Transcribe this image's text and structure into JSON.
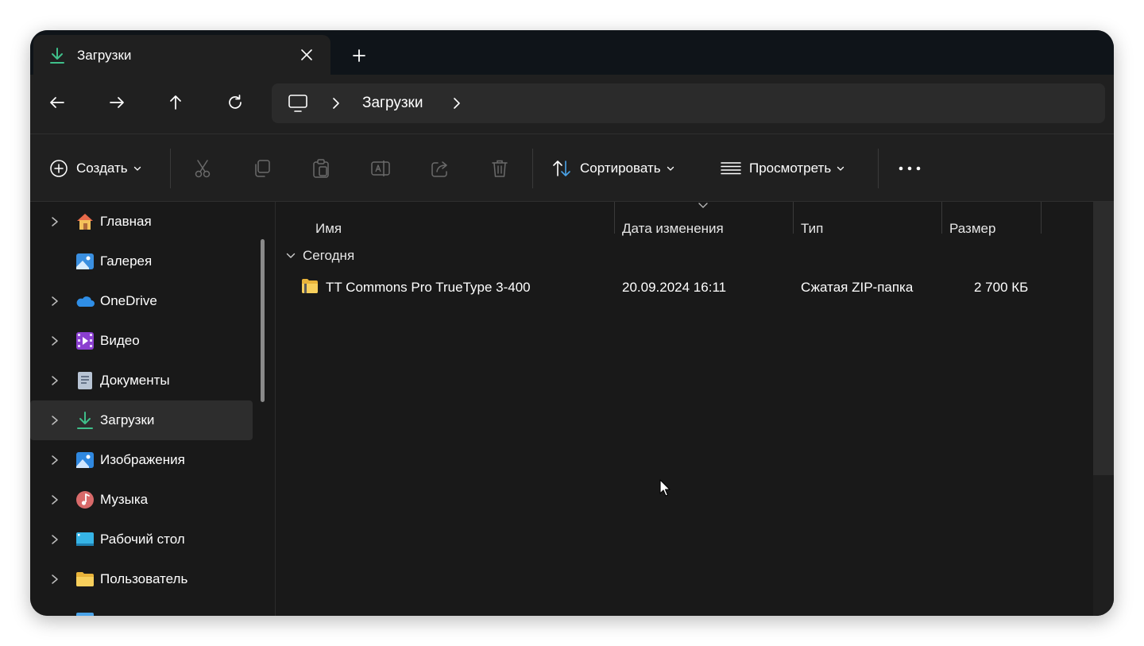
{
  "tab": {
    "title": "Загрузки",
    "icon": "download-icon",
    "close_icon": "close-icon"
  },
  "new_tab_icon": "plus-icon",
  "nav": {
    "back_icon": "arrow-left-icon",
    "forward_icon": "arrow-right-icon",
    "up_icon": "arrow-up-icon",
    "refresh_icon": "refresh-icon"
  },
  "address": {
    "root_icon": "computer-icon",
    "segment": "Загрузки"
  },
  "toolbar": {
    "create_label": "Создать",
    "sort_label": "Сортировать",
    "view_label": "Просмотреть",
    "icons": [
      "cut-icon",
      "copy-icon",
      "paste-icon",
      "rename-icon",
      "share-icon",
      "delete-icon",
      "more-icon"
    ]
  },
  "sidebar": {
    "items": [
      {
        "label": "Главная",
        "icon": "home-icon",
        "expandable": true
      },
      {
        "label": "Галерея",
        "icon": "gallery-icon",
        "expandable": false
      },
      {
        "label": "OneDrive",
        "icon": "onedrive-icon",
        "expandable": true
      },
      {
        "label": "Видео",
        "icon": "video-icon",
        "expandable": true
      },
      {
        "label": "Документы",
        "icon": "documents-icon",
        "expandable": true
      },
      {
        "label": "Загрузки",
        "icon": "download-icon",
        "expandable": true,
        "selected": true
      },
      {
        "label": "Изображения",
        "icon": "pictures-icon",
        "expandable": true
      },
      {
        "label": "Музыка",
        "icon": "music-icon",
        "expandable": true
      },
      {
        "label": "Рабочий стол",
        "icon": "desktop-icon",
        "expandable": true
      },
      {
        "label": "Пользователь",
        "icon": "folder-icon",
        "expandable": true
      }
    ]
  },
  "columns": {
    "name": "Имя",
    "date": "Дата изменения",
    "type": "Тип",
    "size": "Размер"
  },
  "group": {
    "label": "Сегодня"
  },
  "files": [
    {
      "name": "TT Commons Pro TrueType 3-400",
      "date": "20.09.2024 16:11",
      "type": "Сжатая ZIP-папка",
      "size": "2 700 КБ",
      "icon": "zip-folder-icon"
    }
  ],
  "colors": {
    "window_bg": "#191919",
    "chrome_bg": "#202020",
    "tabstrip_bg": "#0f1419",
    "accent_green": "#3fbf8a",
    "selected_bg": "#2d2d2d"
  }
}
